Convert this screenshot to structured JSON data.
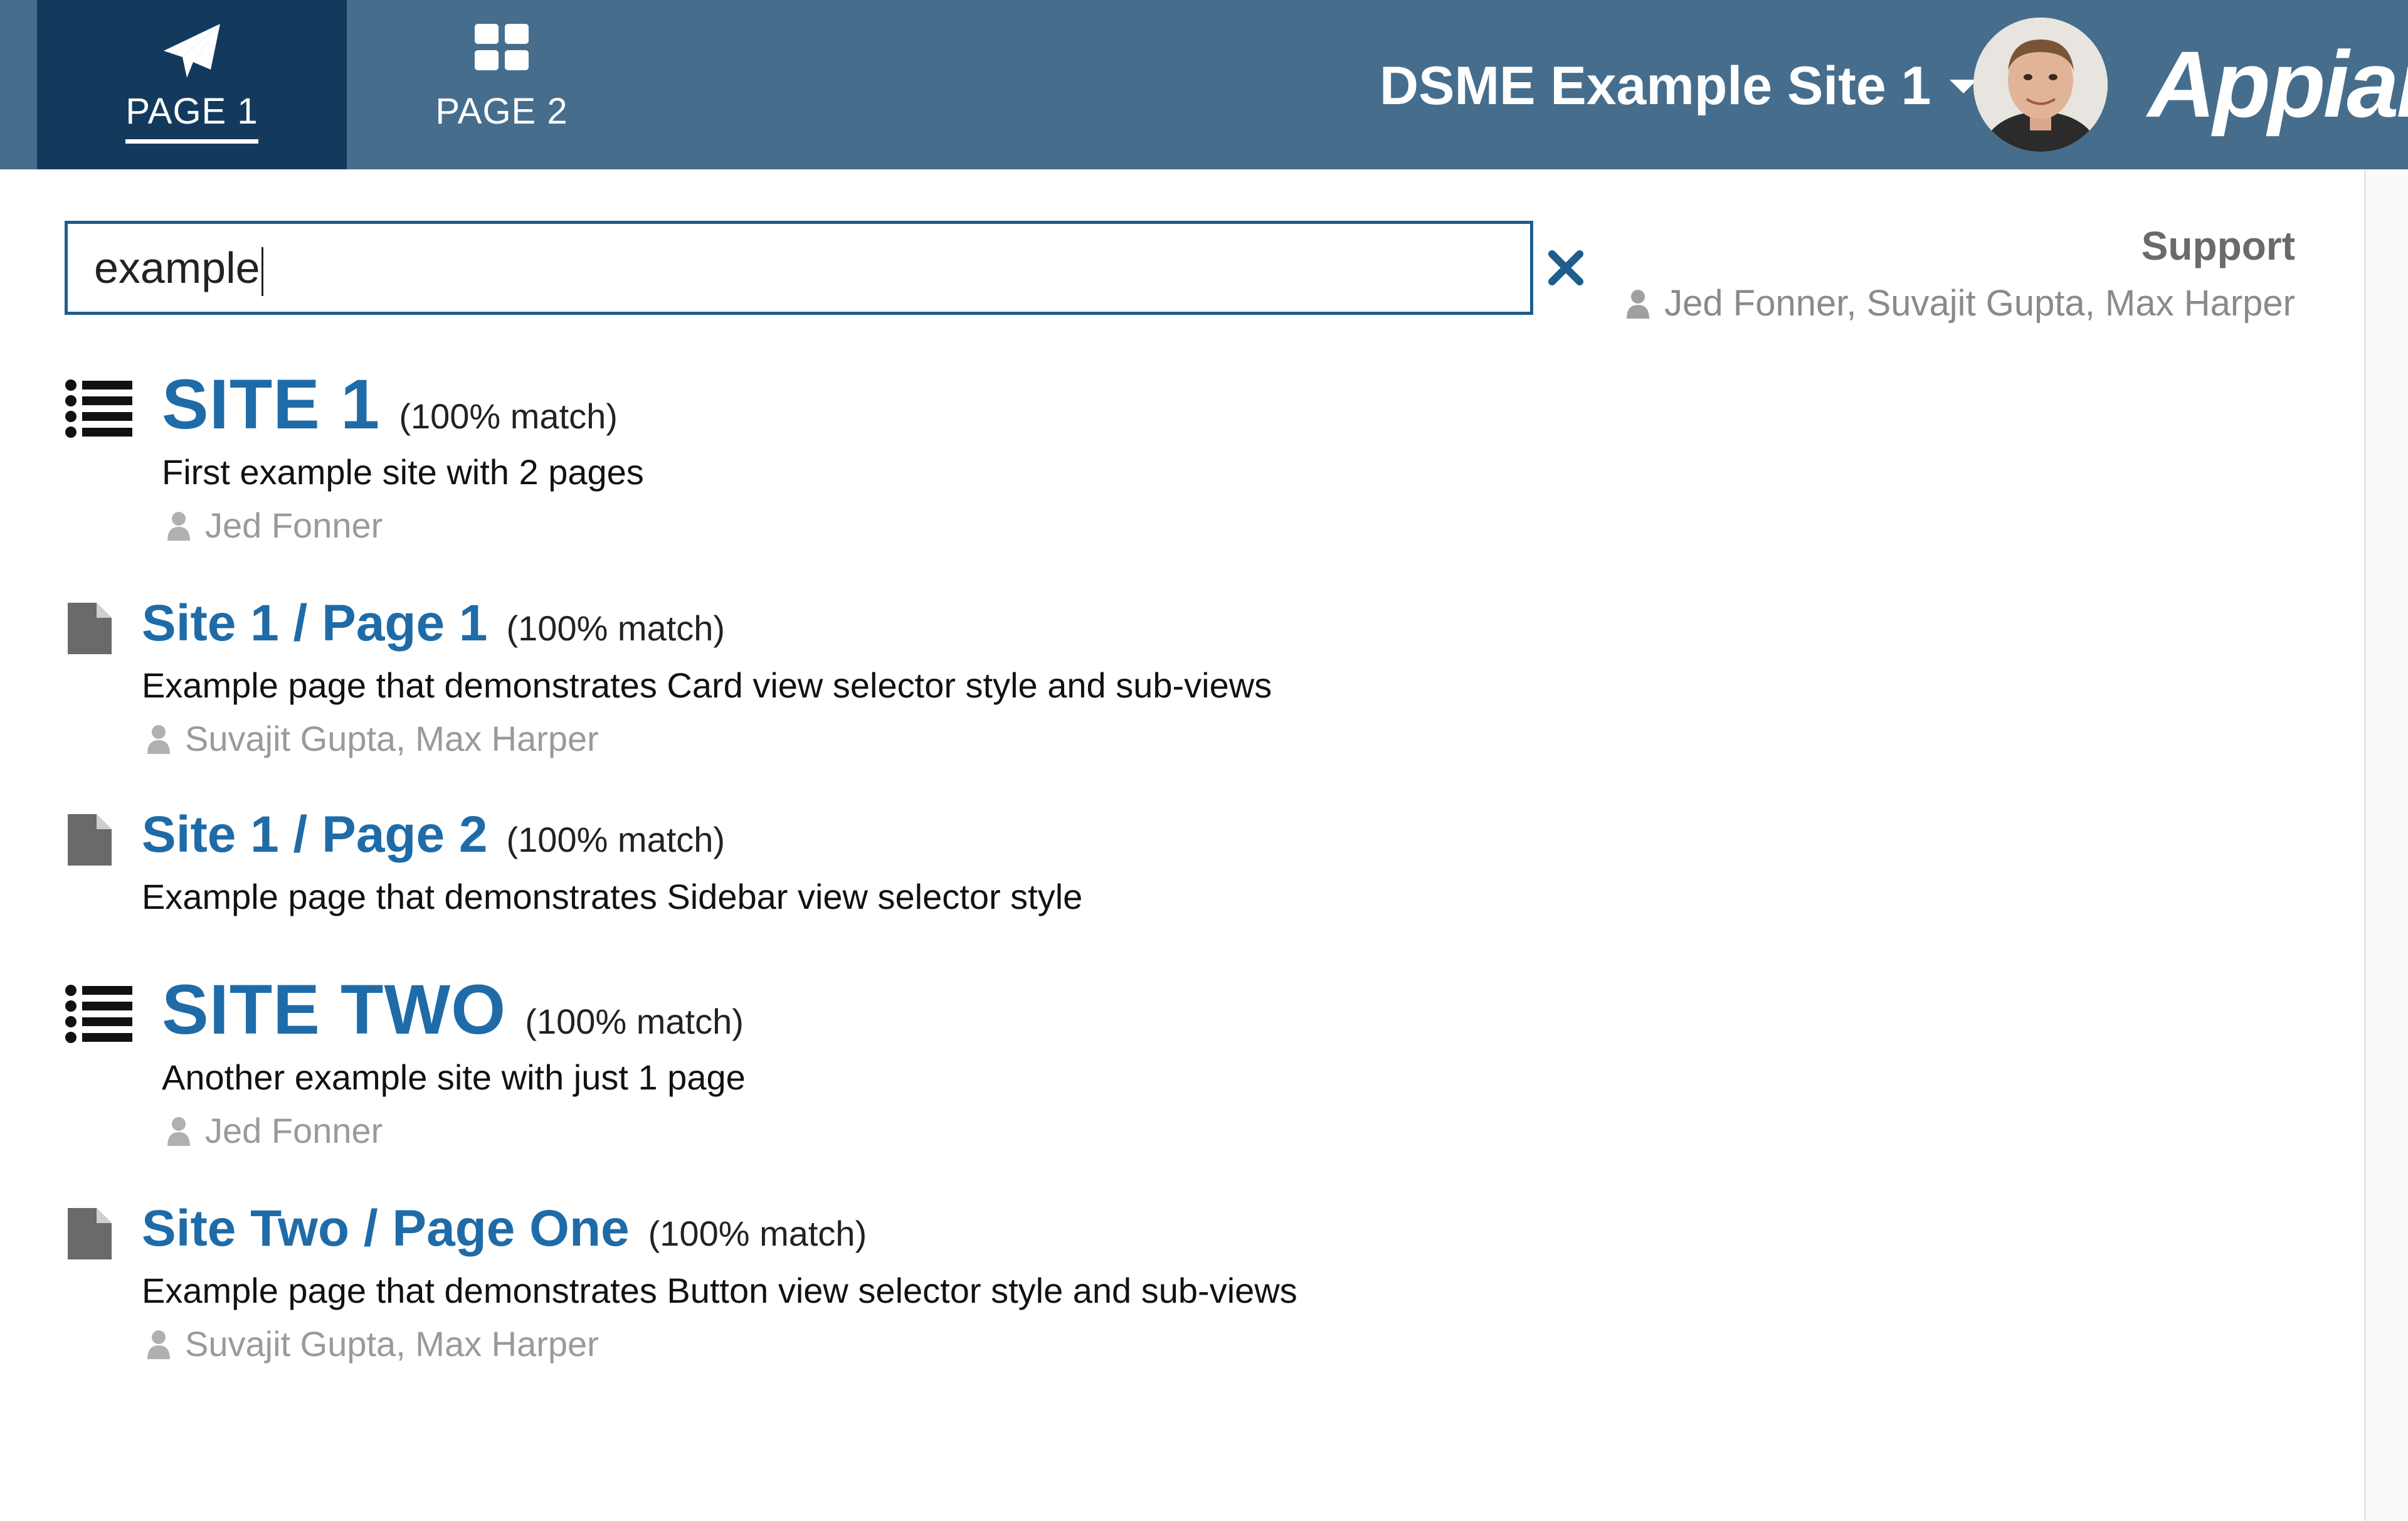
{
  "header": {
    "tabs": [
      {
        "label": "PAGE 1",
        "icon": "paper-plane-icon",
        "active": true
      },
      {
        "label": "PAGE 2",
        "icon": "grid-icon",
        "active": false
      }
    ],
    "site_name": "DSME Example Site 1",
    "brand": "Appian",
    "colors": {
      "header": "#466d8c",
      "active_tab": "#133a5d",
      "link": "#1f6ba8"
    }
  },
  "search": {
    "value": "example"
  },
  "support": {
    "title": "Support",
    "names": "Jed Fonner, Suvajit Gupta, Max Harper"
  },
  "results": [
    {
      "type": "site",
      "title": "SITE 1",
      "match": "(100% match)",
      "description": "First example site with 2 pages",
      "owners": "Jed Fonner"
    },
    {
      "type": "page",
      "title": "Site 1 / Page 1",
      "match": "(100% match)",
      "description": "Example page that demonstrates Card view selector style and sub-views",
      "owners": "Suvajit Gupta, Max Harper"
    },
    {
      "type": "page",
      "title": "Site 1 / Page 2",
      "match": "(100% match)",
      "description": "Example page that demonstrates Sidebar view selector style",
      "owners": ""
    },
    {
      "type": "site",
      "title": "SITE TWO",
      "match": "(100% match)",
      "description": "Another example site with just 1 page",
      "owners": "Jed Fonner"
    },
    {
      "type": "page",
      "title": "Site Two / Page One",
      "match": "(100% match)",
      "description": "Example page that demonstrates Button view selector style and sub-views",
      "owners": "Suvajit Gupta, Max Harper"
    }
  ]
}
